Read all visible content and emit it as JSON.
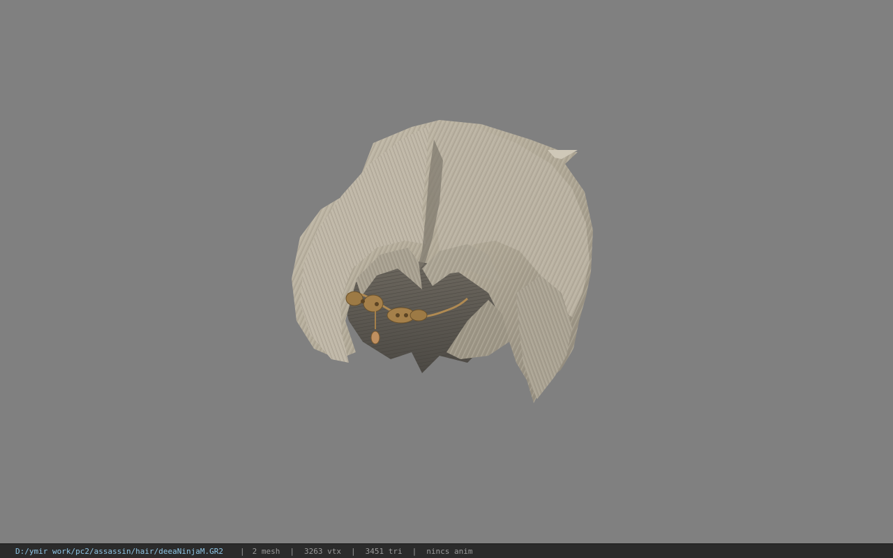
{
  "viewport": {
    "background_color": "#808080",
    "model": {
      "name": "hair-model",
      "hair_color": "#b3ab9c",
      "hair_shadow_color": "#5a5650",
      "ornament_color": "#b08a52"
    }
  },
  "status_bar": {
    "file_path": "D:/ymir work/pc2/assassin/hair/deeaNinjaM.GR2",
    "separator": "|",
    "mesh_count": "2 mesh",
    "vertex_count": "3263 vtx",
    "triangle_count": "3451 tri",
    "animation": "nincs anim",
    "path_color": "#8fc6e6",
    "text_color": "#9a9a9a"
  }
}
